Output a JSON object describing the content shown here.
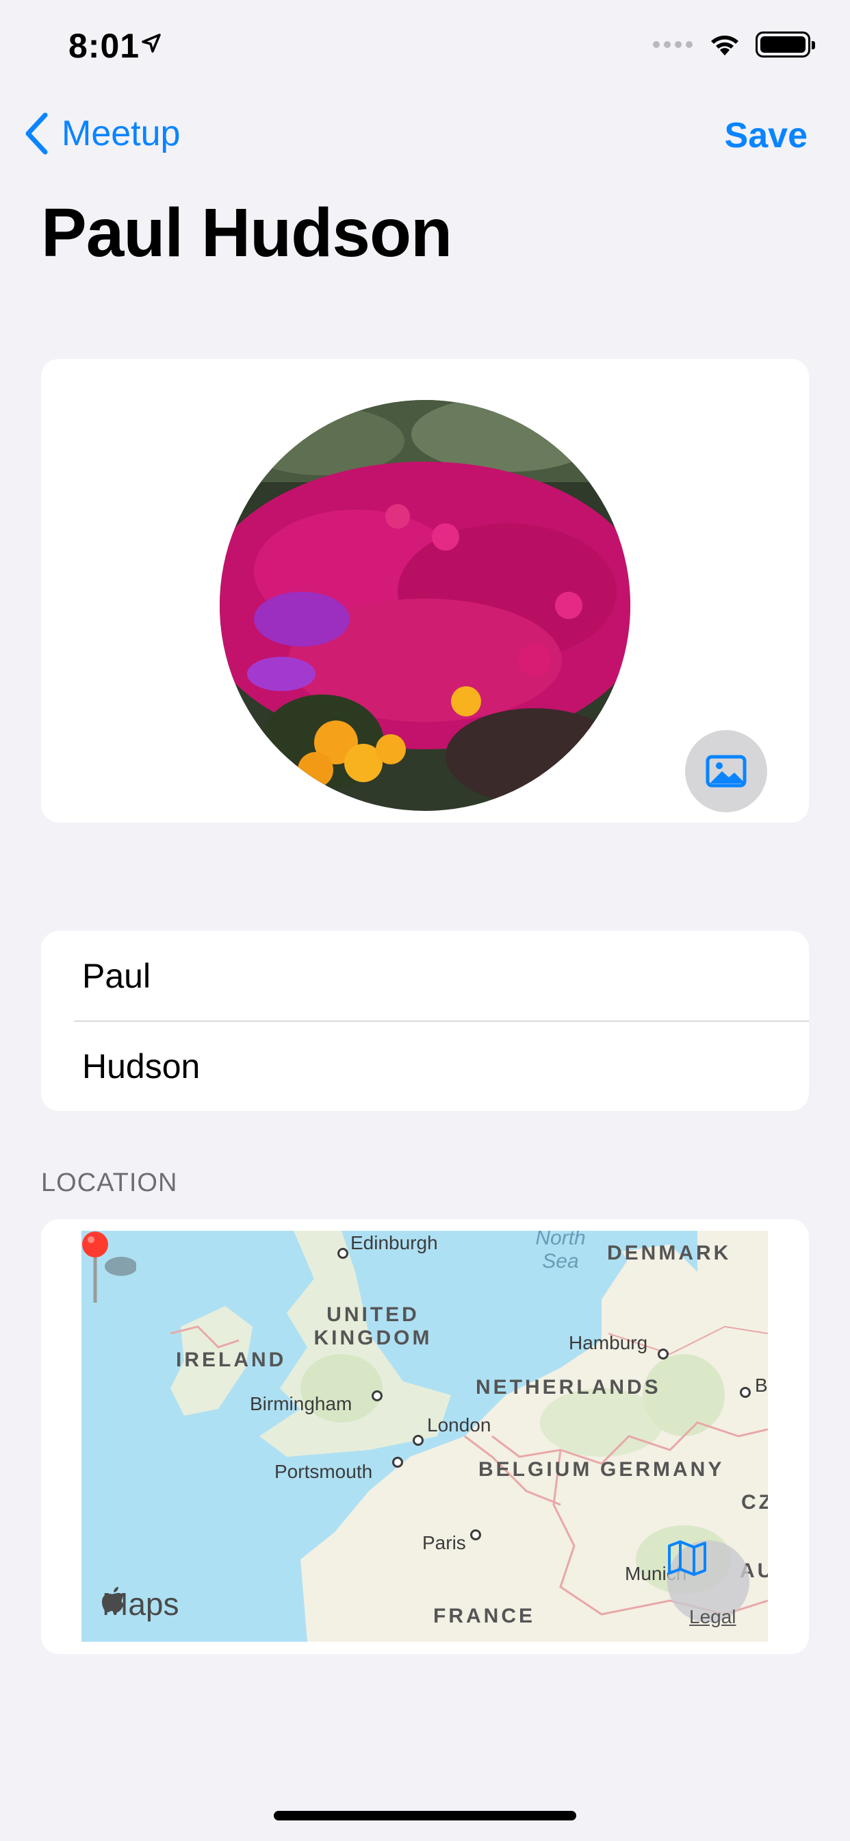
{
  "status_bar": {
    "time": "8:01"
  },
  "nav": {
    "back_label": "Meetup",
    "save_label": "Save",
    "title": "Paul Hudson"
  },
  "photo": {
    "picker_icon": "photo-icon"
  },
  "name_fields": {
    "first": "Paul",
    "last": "Hudson"
  },
  "location": {
    "header": "LOCATION",
    "map": {
      "labels": [
        "Edinburgh",
        "North Sea",
        "DENMARK",
        "UNITED KINGDOM",
        "IRELAND",
        "Hamburg",
        "Birmingham",
        "NETHERLANDS",
        "London",
        "Portsmouth",
        "BELGIUM",
        "GERMANY",
        "Paris",
        "Munich",
        "FRANCE",
        "CZ",
        "AUS",
        "B"
      ],
      "logo": "Maps",
      "legal": "Legal"
    }
  },
  "colors": {
    "accent": "#0a84ff",
    "background": "#f2f2f7",
    "pin": "#ff3b30"
  }
}
